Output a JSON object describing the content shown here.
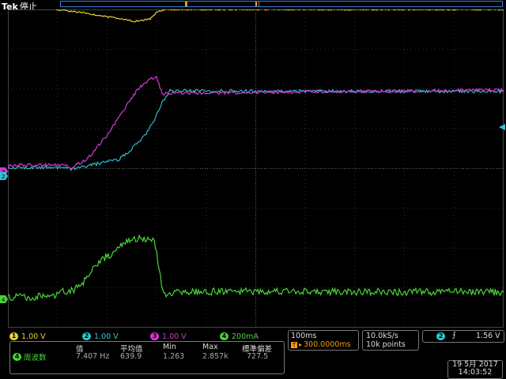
{
  "header": {
    "brand": "Tek",
    "state": "停止"
  },
  "channels": [
    {
      "num": "1",
      "scale": "1.00 V",
      "color": "#e6d23a"
    },
    {
      "num": "2",
      "scale": "1.00 V",
      "color": "#2fc6d6"
    },
    {
      "num": "3",
      "scale": "1.00 V",
      "color": "#d23ad2"
    },
    {
      "num": "4",
      "scale": "200mA",
      "color": "#4bd23a"
    }
  ],
  "timebase": {
    "scale": "100ms",
    "trigger_pos": "300.0000ms",
    "sample_rate": "10.0kS/s",
    "record_length": "10k points"
  },
  "trigger": {
    "source": "2",
    "slope_symbol": "⨍",
    "level": "1.56 V"
  },
  "measurement": {
    "headers": [
      "值",
      "平均值",
      "Min",
      "Max",
      "標準偏差"
    ],
    "channel": "4",
    "label": "周波数",
    "values": [
      "7.407 Hz",
      "639.9",
      "1.263",
      "2.857k",
      "727.5"
    ]
  },
  "timestamp": {
    "date": "19 5月  2017",
    "time": "14:03:52"
  },
  "ground_markers": [
    {
      "num": "3",
      "color": "#d23ad2"
    },
    {
      "num": "2",
      "color": "#2fc6d6"
    },
    {
      "num": "4",
      "color": "#4bd23a"
    }
  ]
}
